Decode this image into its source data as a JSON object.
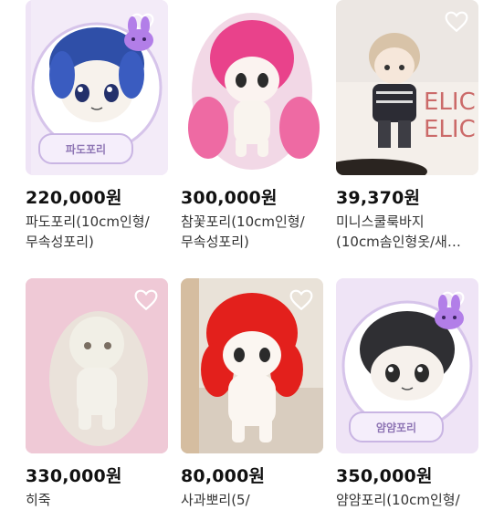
{
  "products": [
    {
      "price": "220,000원",
      "title_line1": "파도포리(10cm인형/",
      "title_line2": "무속성포리)",
      "tag": "파도포리",
      "icon": "heart-outline",
      "bunny": true
    },
    {
      "price": "300,000원",
      "title_line1": "참꽃포리(10cm인형/",
      "title_line2": "무속성포리)",
      "icon": "heart-outline"
    },
    {
      "price": "39,370원",
      "title_line1": "미니스쿨룩바지",
      "title_line2": "(10cm솜인형옷/새…",
      "icon": "heart-outline"
    },
    {
      "price": "330,000원",
      "title_line1": "히죽",
      "title_line2": "",
      "icon": "heart-outline"
    },
    {
      "price": "80,000원",
      "title_line1": "사과뽀리(5/",
      "title_line2": "",
      "icon": "heart-outline"
    },
    {
      "price": "350,000원",
      "title_line1": "얌얌포리(10cm인형/",
      "title_line2": "",
      "tag": "얌얌포리",
      "icon": "heart-outline",
      "bunny": true
    }
  ],
  "colors": {
    "heart_stroke": "#ffffff",
    "tag_text": "#8f76b5",
    "price_text": "#111111"
  }
}
